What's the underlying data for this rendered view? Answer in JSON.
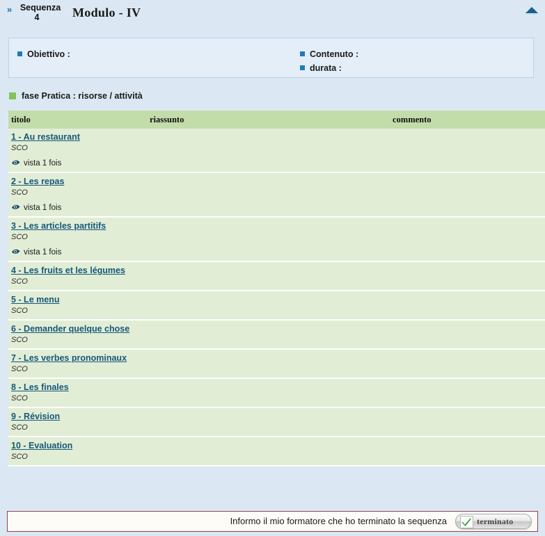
{
  "header": {
    "sequence_label": "Sequenza",
    "sequence_number": "4",
    "chevron_icon": "double-chevron-right-icon",
    "module_title": "Modulo - IV",
    "collapse_icon": "collapse-up-arrow-icon"
  },
  "objective_panel": {
    "left": [
      {
        "label": "Obiettivo :",
        "value": ""
      }
    ],
    "right": [
      {
        "label": "Contenuto :",
        "value": ""
      },
      {
        "label": "durata :",
        "value": ""
      }
    ]
  },
  "phase": {
    "title": "fase Pratica : risorse / attività"
  },
  "table": {
    "columns": {
      "titolo": "titolo",
      "riassunto": "riassunto",
      "commento": "commento"
    },
    "rows": [
      {
        "title": "1 - Au restaurant",
        "type": "SCO",
        "seen": "vista 1 fois",
        "riassunto": "",
        "commento": ""
      },
      {
        "title": "2 - Les repas",
        "type": "SCO",
        "seen": "vista 1 fois",
        "riassunto": "",
        "commento": ""
      },
      {
        "title": "3 - Les articles partitifs",
        "type": "SCO",
        "seen": "vista 1 fois",
        "riassunto": "",
        "commento": ""
      },
      {
        "title": "4 - Les fruits et les légumes",
        "type": "SCO",
        "seen": "",
        "riassunto": "",
        "commento": ""
      },
      {
        "title": "5 - Le menu",
        "type": "SCO",
        "seen": "",
        "riassunto": "",
        "commento": ""
      },
      {
        "title": "6 - Demander quelque chose",
        "type": "SCO",
        "seen": "",
        "riassunto": "",
        "commento": ""
      },
      {
        "title": "7 - Les verbes pronominaux",
        "type": "SCO",
        "seen": "",
        "riassunto": "",
        "commento": ""
      },
      {
        "title": "8 - Les finales",
        "type": "SCO",
        "seen": "",
        "riassunto": "",
        "commento": ""
      },
      {
        "title": "9 - Révision",
        "type": "SCO",
        "seen": "",
        "riassunto": "",
        "commento": ""
      },
      {
        "title": "10 - Evaluation",
        "type": "SCO",
        "seen": "",
        "riassunto": "",
        "commento": ""
      }
    ]
  },
  "footer": {
    "message": "Informo il mio formatore che ho terminato la sequenza",
    "button_label": "terminato",
    "button_icon": "green-check-icon"
  },
  "colors": {
    "page_background": "#dbe8f4",
    "panel_background": "#e3eef8",
    "table_header_green": "#c2dcaa",
    "table_row_green": "#e2edd6",
    "link_blue": "#15597a",
    "bullet_blue": "#1f7bb6",
    "bullet_green": "#84c35a",
    "footer_border_red": "#9b3b4c"
  }
}
